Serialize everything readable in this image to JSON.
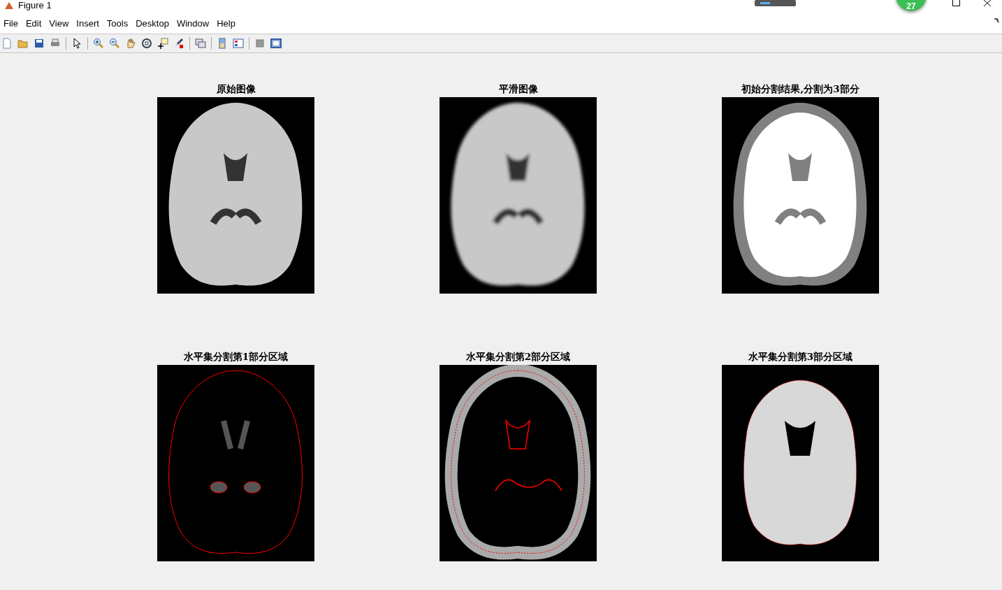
{
  "window": {
    "title": "Figure 1",
    "badge": "27"
  },
  "menu": [
    "File",
    "Edit",
    "View",
    "Insert",
    "Tools",
    "Desktop",
    "Window",
    "Help"
  ],
  "plots": [
    {
      "title": "原始图像",
      "kind": "scan"
    },
    {
      "title": "平滑图像",
      "kind": "blurred"
    },
    {
      "title": "初始分割结果,分割为3部分",
      "kind": "segmented"
    },
    {
      "title": "水平集分割第1部分区域",
      "kind": "contour-dark"
    },
    {
      "title": "水平集分割第2部分区域",
      "kind": "contour-gray"
    },
    {
      "title": "水平集分割第3部分区域",
      "kind": "contour-white"
    }
  ]
}
